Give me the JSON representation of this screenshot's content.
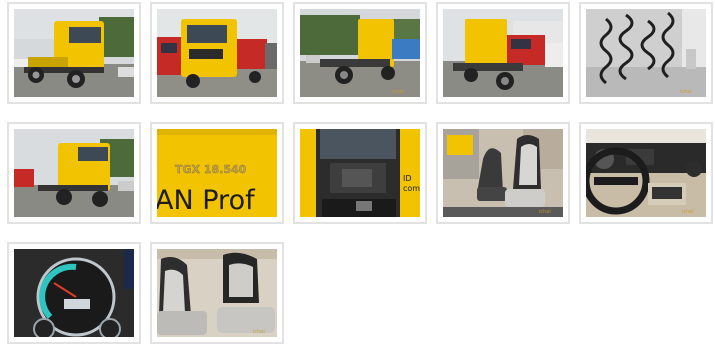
{
  "gallery": {
    "photos": [
      {
        "subject": "yellow truck front-left exterior",
        "watermark": ""
      },
      {
        "subject": "yellow truck front with red trucks",
        "watermark": ""
      },
      {
        "subject": "yellow truck rear-left exterior",
        "watermark": ""
      },
      {
        "subject": "yellow truck rear with red truck",
        "watermark": ""
      },
      {
        "subject": "air and electric coil hoses",
        "watermark": ""
      },
      {
        "subject": "yellow truck front-left in yard",
        "watermark": ""
      },
      {
        "subject": "side lettering closeup",
        "model_badge": "TGX 18.540",
        "side_text": "AN Prof"
      },
      {
        "subject": "cab door open interior",
        "side_text": "ID\ncom"
      },
      {
        "subject": "grey seats interior",
        "watermark": ""
      },
      {
        "subject": "steering wheel and dashboard",
        "watermark": ""
      },
      {
        "subject": "instrument cluster",
        "watermark": ""
      },
      {
        "subject": "rear seats grey",
        "watermark": ""
      }
    ],
    "colors": {
      "truck_yellow": "#f2c300",
      "sky": "#cfd4d6",
      "ground": "#8a8a84",
      "trees": "#4d6b3a",
      "border": "#e2e2e2"
    }
  }
}
